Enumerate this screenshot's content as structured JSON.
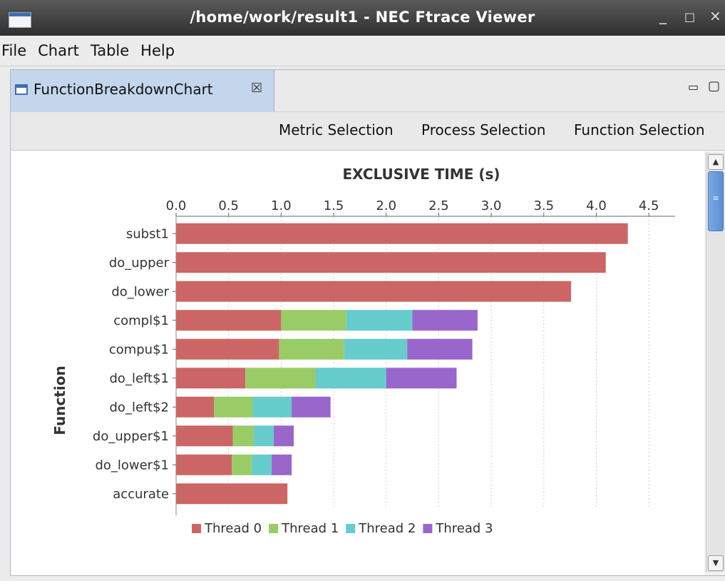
{
  "window": {
    "title": "/home/work/result1 - NEC Ftrace Viewer",
    "minimize": "_",
    "maximize": "□",
    "close": "×"
  },
  "menu": [
    "File",
    "Chart",
    "Table",
    "Help"
  ],
  "view": {
    "tab_label": "FunctionBreakdownChart",
    "tab_close": "☒",
    "minimize": "▭",
    "maximize": "▢"
  },
  "toolbar": {
    "metric": "Metric Selection",
    "process": "Process Selection",
    "function": "Function Selection"
  },
  "colors": {
    "thread0": "#cc6666",
    "thread1": "#99cc66",
    "thread2": "#66cccc",
    "thread3": "#9966cc"
  },
  "chart_data": {
    "type": "bar",
    "orientation": "horizontal",
    "stacked": true,
    "title": "EXCLUSIVE TIME (s)",
    "ylabel": "Function",
    "xlabel": "EXCLUSIVE TIME (s)",
    "xlim": [
      0,
      4.75
    ],
    "x_ticks": [
      "0.0",
      "0.5",
      "1.0",
      "1.5",
      "2.0",
      "2.5",
      "3.0",
      "3.5",
      "4.0",
      "4.5"
    ],
    "grid": true,
    "legend_position": "bottom",
    "categories": [
      "subst1",
      "do_upper",
      "do_lower",
      "compl$1",
      "compu$1",
      "do_left$1",
      "do_left$2",
      "do_upper$1",
      "do_lower$1",
      "accurate"
    ],
    "series": [
      {
        "name": "Thread 0",
        "values": [
          4.3,
          4.09,
          3.76,
          1.0,
          0.98,
          0.66,
          0.36,
          0.54,
          0.53,
          1.06
        ]
      },
      {
        "name": "Thread 1",
        "values": [
          0,
          0,
          0,
          0.62,
          0.62,
          0.67,
          0.37,
          0.2,
          0.19,
          0
        ]
      },
      {
        "name": "Thread 2",
        "values": [
          0,
          0,
          0,
          0.63,
          0.6,
          0.67,
          0.37,
          0.19,
          0.19,
          0
        ]
      },
      {
        "name": "Thread 3",
        "values": [
          0,
          0,
          0,
          0.62,
          0.62,
          0.67,
          0.37,
          0.19,
          0.19,
          0
        ]
      }
    ]
  }
}
